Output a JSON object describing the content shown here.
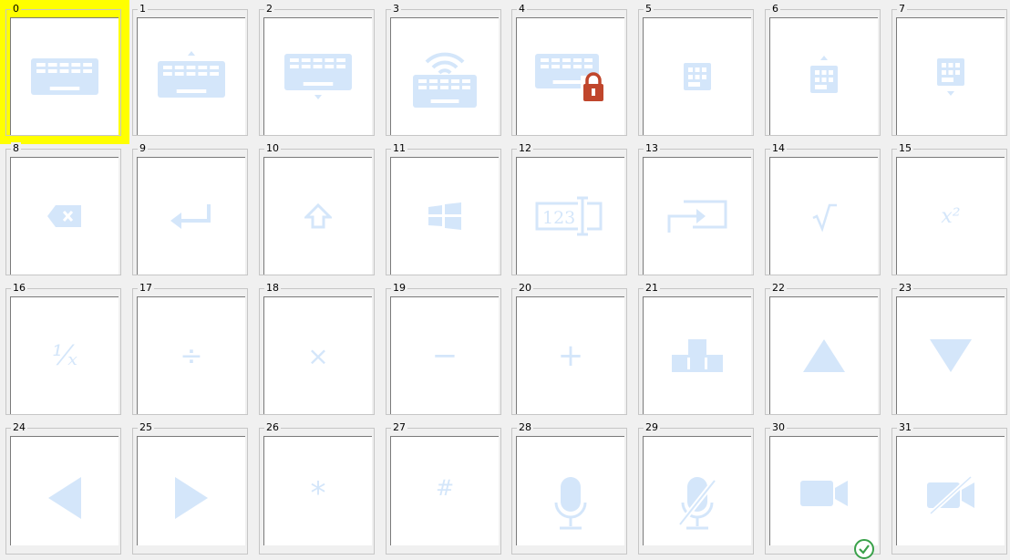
{
  "selected_index": 0,
  "colors": {
    "highlight": "#ffff00",
    "icon": "#d4e6fa",
    "lock": "#c0462c",
    "check": "#3aa14a"
  },
  "cells": [
    {
      "label": "0",
      "icon": "keyboard-icon"
    },
    {
      "label": "1",
      "icon": "keyboard-show-icon"
    },
    {
      "label": "2",
      "icon": "keyboard-hide-icon"
    },
    {
      "label": "3",
      "icon": "keyboard-wireless-icon"
    },
    {
      "label": "4",
      "icon": "keyboard-locked-icon"
    },
    {
      "label": "5",
      "icon": "keypad-icon"
    },
    {
      "label": "6",
      "icon": "keypad-show-icon"
    },
    {
      "label": "7",
      "icon": "keypad-hide-icon"
    },
    {
      "label": "8",
      "icon": "backspace-icon"
    },
    {
      "label": "9",
      "icon": "enter-icon"
    },
    {
      "label": "10",
      "icon": "shift-icon"
    },
    {
      "label": "11",
      "icon": "windows-icon"
    },
    {
      "label": "12",
      "icon": "numeric-input-icon",
      "text": "123"
    },
    {
      "label": "13",
      "icon": "tab-icon"
    },
    {
      "label": "14",
      "icon": "square-root-icon",
      "text": "√‾"
    },
    {
      "label": "15",
      "icon": "square-icon",
      "text": "x²"
    },
    {
      "label": "16",
      "icon": "reciprocal-icon",
      "text": "¹⁄ₓ"
    },
    {
      "label": "17",
      "icon": "divide-icon",
      "text": "÷"
    },
    {
      "label": "18",
      "icon": "multiply-icon",
      "text": "×"
    },
    {
      "label": "19",
      "icon": "minus-icon",
      "text": "−"
    },
    {
      "label": "20",
      "icon": "plus-icon",
      "text": "+"
    },
    {
      "label": "21",
      "icon": "arrow-keys-icon"
    },
    {
      "label": "22",
      "icon": "triangle-up-icon"
    },
    {
      "label": "23",
      "icon": "triangle-down-icon"
    },
    {
      "label": "24",
      "icon": "triangle-left-icon"
    },
    {
      "label": "25",
      "icon": "triangle-right-icon"
    },
    {
      "label": "26",
      "icon": "asterisk-icon",
      "text": "*"
    },
    {
      "label": "27",
      "icon": "hash-icon",
      "text": "#"
    },
    {
      "label": "28",
      "icon": "microphone-icon"
    },
    {
      "label": "29",
      "icon": "microphone-off-icon"
    },
    {
      "label": "30",
      "icon": "video-camera-active-icon"
    },
    {
      "label": "31",
      "icon": "video-camera-off-icon"
    }
  ]
}
